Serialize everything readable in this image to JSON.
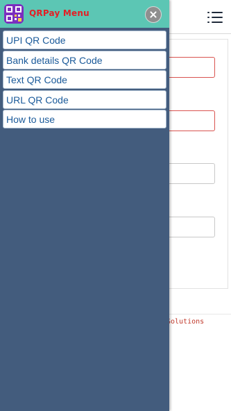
{
  "background": {
    "footer_text": "Solutions"
  },
  "drawer": {
    "title": "QRPay Menu",
    "close_icon": "close-circle-icon",
    "items": [
      {
        "label": "UPI QR Code"
      },
      {
        "label": "Bank details QR Code"
      },
      {
        "label": "Text QR Code"
      },
      {
        "label": "URL QR Code"
      },
      {
        "label": "How to use"
      }
    ]
  },
  "colors": {
    "drawer_bg": "#435c7d",
    "header_bg": "#5cc6b4",
    "title": "#e31e24",
    "link": "#1a5a9a",
    "logo_bg": "#7b2fbf",
    "error_border": "#d9534f"
  }
}
